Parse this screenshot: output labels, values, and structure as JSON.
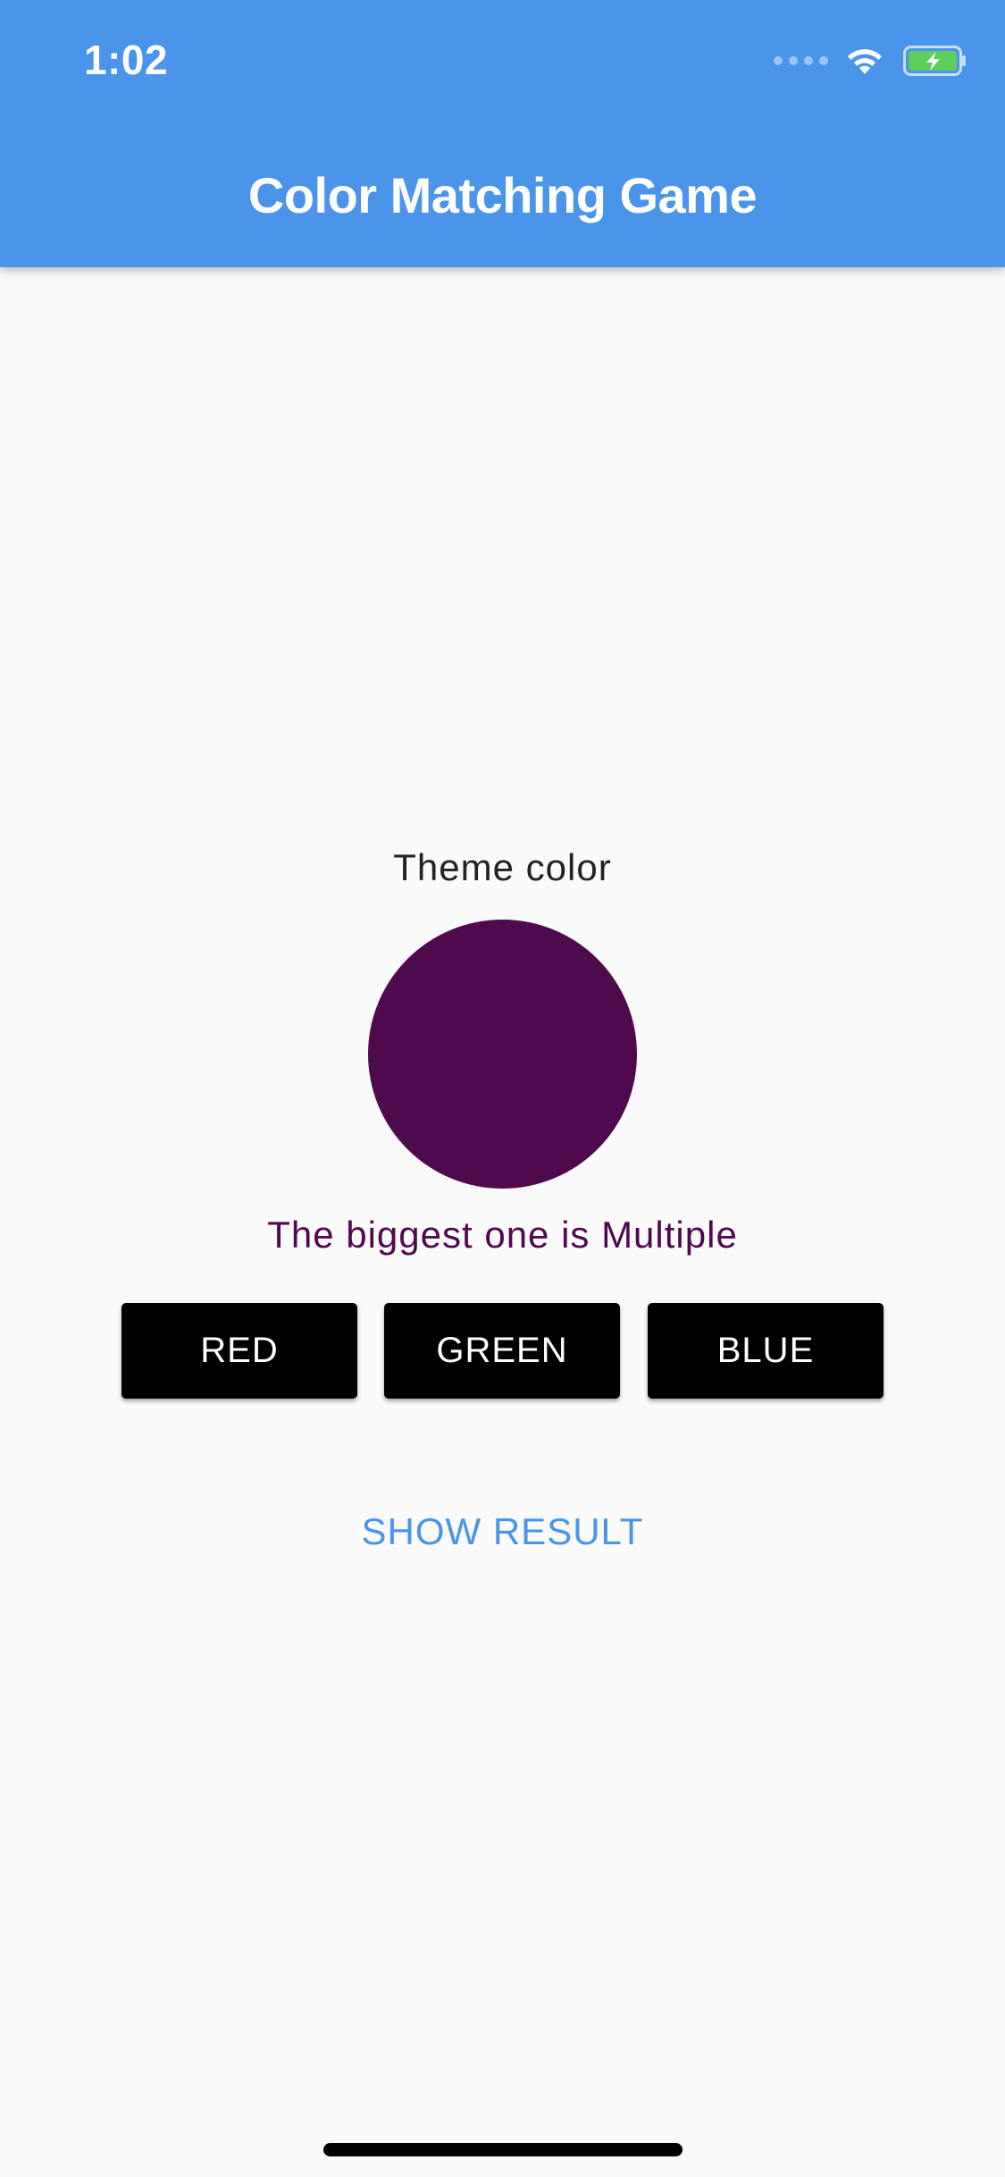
{
  "status_bar": {
    "time": "1:02",
    "icons": [
      "cellular-signal-icon",
      "wifi-icon",
      "battery-charging-icon"
    ]
  },
  "app_bar": {
    "title": "Color Matching Game"
  },
  "game": {
    "theme_label": "Theme color",
    "swatch_color": "#4e0a4d",
    "hint_text": "The biggest one is Multiple",
    "buttons": [
      {
        "label": "RED"
      },
      {
        "label": "GREEN"
      },
      {
        "label": "BLUE"
      }
    ],
    "show_result_label": "SHOW RESULT"
  },
  "colors": {
    "app_bar": "#4a94ea",
    "background": "#fafafa",
    "button_bg": "#000000",
    "button_text": "#ffffff",
    "accent_text": "#4a94ea",
    "hint_text": "#4e0a4d",
    "battery_fill": "#5ecd5a"
  }
}
